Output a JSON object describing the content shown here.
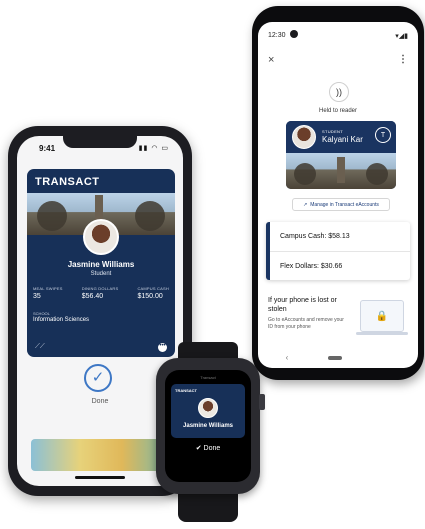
{
  "android": {
    "status_time": "12:30",
    "status_icons": "▾◢▮",
    "close_icon": "×",
    "more_icon": "⋮",
    "nfc_icon": "))",
    "held_text": "Held to reader",
    "card": {
      "label": "STUDENT",
      "name": "Kalyani Kar",
      "seal": "T"
    },
    "manage_link": "Manage in Transact eAccounts",
    "balances": [
      "Campus Cash: $58.13",
      "Flex Dollars: $30.66"
    ],
    "lost_title": "If your phone is lost or stolen",
    "lost_body": "Go to eAccounts and remove your ID from your phone",
    "lock_icon": "🔒",
    "back_icon": "‹"
  },
  "iphone": {
    "time": "9:41",
    "status_icons": "▮▮ ◠ ▭",
    "brand": "TRANSACT",
    "name": "Jasmine Williams",
    "role": "Student",
    "stats": [
      {
        "label": "MEAL SWIPES",
        "value": "35"
      },
      {
        "label": "DINING DOLLARS",
        "value": "$56.40"
      },
      {
        "label": "CAMPUS CASH",
        "value": "$150.00"
      }
    ],
    "school_label": "SCHOOL",
    "school_value": "Information Sciences",
    "nfc_icon": "⟋⟋",
    "more_icon": "•••",
    "check_icon": "✓",
    "done_label": "Done"
  },
  "watch": {
    "top_label": "Transact",
    "brand": "TRANSACT",
    "name": "Jasmine Williams",
    "done_label": "✔ Done"
  }
}
